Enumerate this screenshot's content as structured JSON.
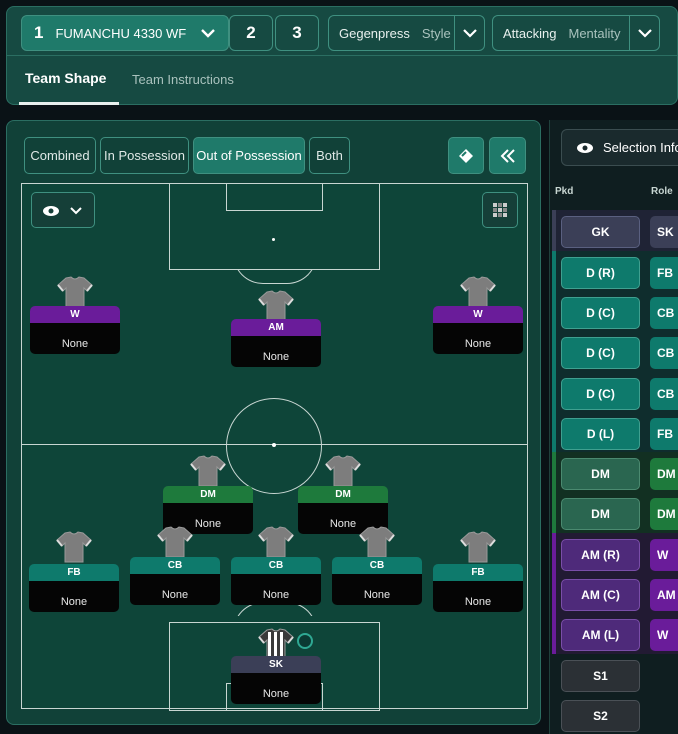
{
  "tactic": {
    "number": "1",
    "name": "FUMANCHU 4330 WF",
    "slot2": "2",
    "slot3": "3"
  },
  "style": {
    "label": "Gegenpress",
    "sub": "Style"
  },
  "mentality": {
    "label": "Attacking",
    "sub": "Mentality"
  },
  "tabs": {
    "team_shape": "Team Shape",
    "team_instructions": "Team Instructions"
  },
  "views": [
    "Combined",
    "In Possession",
    "Out of Possession",
    "Both"
  ],
  "pitch_players": [
    {
      "role": "W",
      "name": "None",
      "color": "#6a1c9a"
    },
    {
      "role": "AM",
      "name": "None",
      "color": "#6a1c9a"
    },
    {
      "role": "W",
      "name": "None",
      "color": "#6a1c9a"
    },
    {
      "role": "DM",
      "name": "None",
      "color": "#1e7a3c"
    },
    {
      "role": "DM",
      "name": "None",
      "color": "#1e7a3c"
    },
    {
      "role": "FB",
      "name": "None",
      "color": "#0e7a6c"
    },
    {
      "role": "CB",
      "name": "None",
      "color": "#0e7a6c"
    },
    {
      "role": "CB",
      "name": "None",
      "color": "#0e7a6c"
    },
    {
      "role": "CB",
      "name": "None",
      "color": "#0e7a6c"
    },
    {
      "role": "FB",
      "name": "None",
      "color": "#0e7a6c"
    },
    {
      "role": "SK",
      "name": "None",
      "color": "#3b3f57"
    }
  ],
  "selection": {
    "button": "Selection Info",
    "col_pkd": "Pkd",
    "col_role": "Role",
    "rows": [
      {
        "pos": "GK",
        "role": "SK",
        "group": "gk"
      },
      {
        "pos": "D (R)",
        "role": "FB",
        "group": "def"
      },
      {
        "pos": "D (C)",
        "role": "CB",
        "group": "def"
      },
      {
        "pos": "D (C)",
        "role": "CB",
        "group": "def"
      },
      {
        "pos": "D (C)",
        "role": "CB",
        "group": "def"
      },
      {
        "pos": "D (L)",
        "role": "FB",
        "group": "def"
      },
      {
        "pos": "DM",
        "role": "DM",
        "group": "dm"
      },
      {
        "pos": "DM",
        "role": "DM",
        "group": "dm"
      },
      {
        "pos": "AM (R)",
        "role": "W",
        "group": "am"
      },
      {
        "pos": "AM (C)",
        "role": "AM",
        "group": "am"
      },
      {
        "pos": "AM (L)",
        "role": "W",
        "group": "am"
      },
      {
        "pos": "S1",
        "role": "",
        "group": "sub"
      },
      {
        "pos": "S2",
        "role": "",
        "group": "sub"
      }
    ]
  },
  "colors": {
    "gk": "#3b3f57",
    "def": "#0e7a6c",
    "dm": "#1e7a3c",
    "am": "#6a1c9a",
    "accent": "#1f7a6a"
  }
}
